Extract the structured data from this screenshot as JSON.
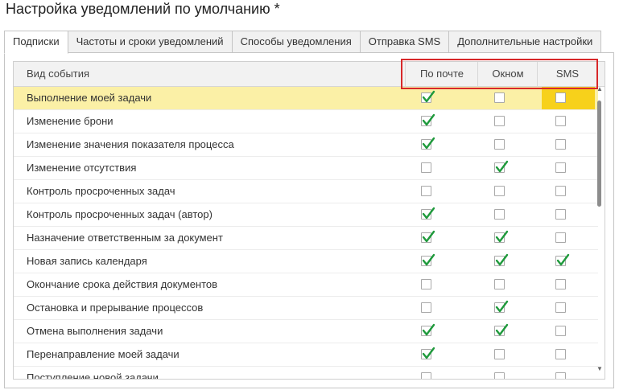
{
  "window": {
    "title": "Настройка уведомлений по умолчанию *"
  },
  "tabs": [
    {
      "label": "Подписки",
      "active": true
    },
    {
      "label": "Частоты и сроки уведомлений",
      "active": false
    },
    {
      "label": "Способы уведомления",
      "active": false
    },
    {
      "label": "Отправка SMS",
      "active": false
    },
    {
      "label": "Дополнительные настройки",
      "active": false
    }
  ],
  "table": {
    "columns": {
      "event": "Вид события",
      "mail": "По почте",
      "window": "Окном",
      "sms": "SMS"
    },
    "rows": [
      {
        "event": "Выполнение моей задачи",
        "mail": true,
        "window": false,
        "sms": false,
        "selected": true
      },
      {
        "event": "Изменение брони",
        "mail": true,
        "window": false,
        "sms": false
      },
      {
        "event": "Изменение значения показателя процесса",
        "mail": true,
        "window": false,
        "sms": false
      },
      {
        "event": "Изменение отсутствия",
        "mail": false,
        "window": true,
        "sms": false
      },
      {
        "event": "Контроль просроченных задач",
        "mail": false,
        "window": false,
        "sms": false
      },
      {
        "event": "Контроль просроченных задач (автор)",
        "mail": true,
        "window": false,
        "sms": false
      },
      {
        "event": "Назначение ответственным за документ",
        "mail": true,
        "window": true,
        "sms": false
      },
      {
        "event": "Новая запись календаря",
        "mail": true,
        "window": true,
        "sms": true
      },
      {
        "event": "Окончание срока действия документов",
        "mail": false,
        "window": false,
        "sms": false
      },
      {
        "event": "Остановка и прерывание процессов",
        "mail": false,
        "window": true,
        "sms": false
      },
      {
        "event": "Отмена выполнения задачи",
        "mail": true,
        "window": true,
        "sms": false
      },
      {
        "event": "Перенаправление моей задачи",
        "mail": true,
        "window": false,
        "sms": false
      },
      {
        "event": "Поступление новой задачи",
        "mail": false,
        "window": false,
        "sms": false
      }
    ]
  },
  "colors": {
    "selected_row": "#fbf0a6",
    "sms_highlight": "#f7d11b",
    "check": "#1f9a3c",
    "highlight_border": "#d8282a"
  }
}
